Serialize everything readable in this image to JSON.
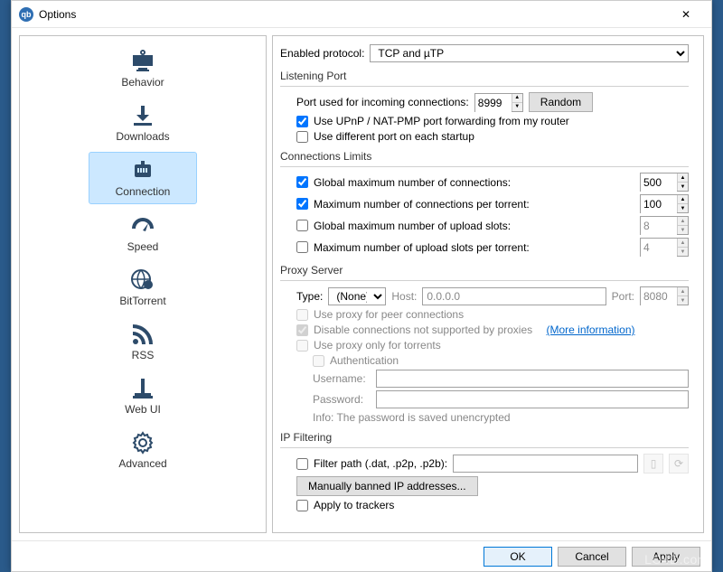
{
  "window": {
    "title": "Options"
  },
  "sidebar": {
    "items": [
      {
        "label": "Behavior"
      },
      {
        "label": "Downloads"
      },
      {
        "label": "Connection"
      },
      {
        "label": "Speed"
      },
      {
        "label": "BitTorrent"
      },
      {
        "label": "RSS"
      },
      {
        "label": "Web UI"
      },
      {
        "label": "Advanced"
      }
    ],
    "selected_index": 2
  },
  "connection": {
    "enabled_protocol": {
      "label": "Enabled protocol:",
      "value": "TCP and µTP"
    },
    "listening_port": {
      "title": "Listening Port",
      "port_label": "Port used for incoming connections:",
      "port_value": "8999",
      "random_label": "Random",
      "upnp": {
        "checked": true,
        "label": "Use UPnP / NAT-PMP port forwarding from my router"
      },
      "diff_port": {
        "checked": false,
        "label": "Use different port on each startup"
      }
    },
    "conn_limits": {
      "title": "Connections Limits",
      "global_conn": {
        "checked": true,
        "label": "Global maximum number of connections:",
        "value": "500"
      },
      "per_torrent_conn": {
        "checked": true,
        "label": "Maximum number of connections per torrent:",
        "value": "100"
      },
      "global_upload": {
        "checked": false,
        "label": "Global maximum number of upload slots:",
        "value": "8"
      },
      "per_torrent_upload": {
        "checked": false,
        "label": "Maximum number of upload slots per torrent:",
        "value": "4"
      }
    },
    "proxy": {
      "title": "Proxy Server",
      "type_label": "Type:",
      "type_value": "(None)",
      "host_label": "Host:",
      "host_value": "0.0.0.0",
      "port_label": "Port:",
      "port_value": "8080",
      "peer": {
        "checked": false,
        "label": "Use proxy for peer connections"
      },
      "disable_unsupported": {
        "checked": true,
        "label": "Disable connections not supported by proxies"
      },
      "more_info": "(More information)",
      "only_torrents": {
        "checked": false,
        "label": "Use proxy only for torrents"
      },
      "auth": {
        "checked": false,
        "label": "Authentication"
      },
      "username_label": "Username:",
      "username_value": "",
      "password_label": "Password:",
      "password_value": "",
      "info": "Info: The password is saved unencrypted"
    },
    "ip_filter": {
      "title": "IP Filtering",
      "filter_path": {
        "checked": false,
        "label": "Filter path (.dat, .p2p, .p2b):",
        "value": ""
      },
      "manual_ban": "Manually banned IP addresses...",
      "apply_trackers": {
        "checked": false,
        "label": "Apply to trackers"
      }
    }
  },
  "buttons": {
    "ok": "OK",
    "cancel": "Cancel",
    "apply": "Apply"
  },
  "watermark": "LO4D.com"
}
